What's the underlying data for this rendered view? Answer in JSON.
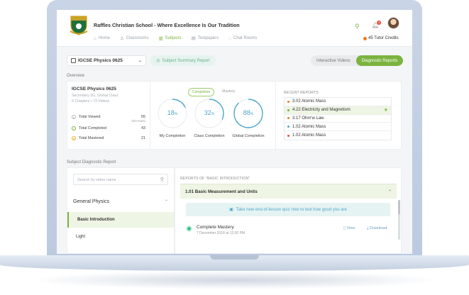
{
  "header": {
    "school_name": "Raffles Christian School - Where Excellence Is Our Tradition",
    "nav": [
      {
        "label": "Home",
        "icon": "home-icon"
      },
      {
        "label": "Classrooms",
        "icon": "classroom-icon"
      },
      {
        "label": "Subjects",
        "icon": "subjects-icon",
        "active": true
      },
      {
        "label": "Testpapers",
        "icon": "testpaper-icon"
      },
      {
        "label": "Chat Rooms",
        "icon": "chat-icon"
      }
    ],
    "notification_count": "4",
    "credits": "45 Tutor Credits"
  },
  "toolbar": {
    "course": "IGCSE Physics 0625",
    "summary_button": "Subject Summary Report",
    "tabs": [
      "Interactive Videos",
      "Diagnostic Reports"
    ],
    "active_tab": "Diagnostic Reports"
  },
  "overview": {
    "label": "Overview",
    "title": "IGCSE Physics 0625",
    "subtitle1": "Secondary 3G, Global Class",
    "subtitle2": "5 Chapters • 73 Videos",
    "stats": [
      {
        "label": "Total Viewed",
        "value": "65",
        "note": "(20 Hours)"
      },
      {
        "label": "Total Completed",
        "value": "43",
        "note": ""
      },
      {
        "label": "Total Mastered",
        "value": "21",
        "note": ""
      }
    ],
    "mode_tabs": [
      "Completion",
      "Mastery"
    ],
    "rings": [
      {
        "label": "My Completion",
        "value": "18",
        "unit": "%",
        "fraction": 0.18
      },
      {
        "label": "Class Completion",
        "value": "32",
        "unit": "%",
        "fraction": 0.32
      },
      {
        "label": "Global Completion",
        "value": "88",
        "unit": "%",
        "fraction": 0.88
      }
    ],
    "reports_title": "RECENT REPORTS",
    "reports": [
      {
        "label": "3.02 Atomic Mass",
        "color": "#e67e22"
      },
      {
        "label": "4.22 Electricity and Magnetism",
        "color": "#7bb33f",
        "selected": true
      },
      {
        "label": "3.17 Ohm'w Law",
        "color": "#e67e22"
      },
      {
        "label": "1.02 Atomic Mass",
        "color": "#4fa7c9"
      },
      {
        "label": "1.02 Atomic Mass",
        "color": "#e74c3c"
      }
    ]
  },
  "diagnostic": {
    "label": "Subject Diagnostic Report",
    "search_placeholder": "Search by video name",
    "category": "General Physics",
    "items": [
      "Basic Introduction",
      "Light"
    ],
    "active_item": "Basic Introduction",
    "reports_of": "REPORTS OF \"BASIC INTRODUCTION\"",
    "section_title": "1.01 Basic Measurement and Units",
    "quiz_banner": "Take new end-of-lesson quiz now to test how good you are",
    "mastery_title": "Complete Mastery",
    "mastery_date": "7 December 2018 at 12:30 PM",
    "view_label": "View",
    "download_label": "Download"
  },
  "colors": {
    "accent": "#7bb33f",
    "ring": "#4fa7c9"
  }
}
